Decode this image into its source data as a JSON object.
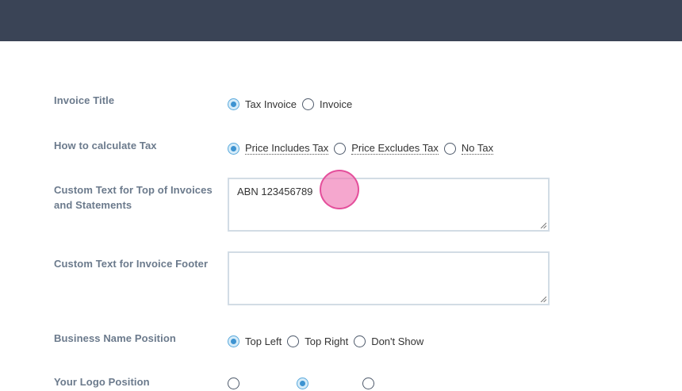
{
  "form": {
    "invoice_title": {
      "label": "Invoice Title",
      "options": [
        "Tax Invoice",
        "Invoice"
      ],
      "selected": "Tax Invoice"
    },
    "tax_calc": {
      "label": "How to calculate Tax",
      "options": [
        "Price Includes Tax",
        "Price Excludes Tax",
        "No Tax"
      ],
      "selected": "Price Includes Tax"
    },
    "custom_top": {
      "label": "Custom Text for Top of Invoices and Statements",
      "value": "ABN 123456789"
    },
    "custom_footer": {
      "label": "Custom Text for Invoice Footer",
      "value": ""
    },
    "business_name_position": {
      "label": "Business Name Position",
      "options": [
        "Top Left",
        "Top Right",
        "Don't Show"
      ],
      "selected": "Top Left"
    },
    "logo_position": {
      "label": "Your Logo Position"
    }
  },
  "colors": {
    "topbar": "#3a4456",
    "label": "#6b7a8c",
    "radio_selected": "#3d93d1",
    "field_border": "#d2dce5"
  }
}
